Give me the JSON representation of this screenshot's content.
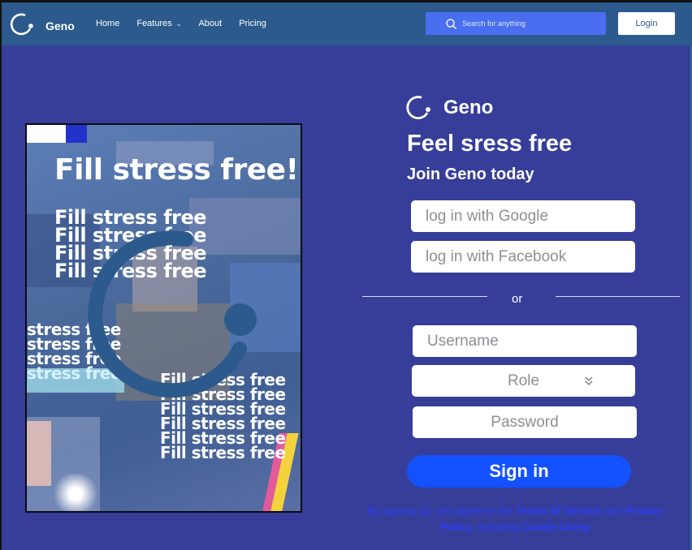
{
  "nav": {
    "brand": "Geno",
    "links": [
      {
        "label": "Home"
      },
      {
        "label": "Features",
        "has_dropdown": true
      },
      {
        "label": "About"
      },
      {
        "label": "Pricing"
      }
    ],
    "search_placeholder": "Search for anything",
    "login_label": "Login"
  },
  "poster": {
    "title": "Fill stress free!",
    "repeat_text": "Fill stress free",
    "short_text": "stress free",
    "ring_color": "#2C5A8C"
  },
  "form": {
    "logo_name": "Geno",
    "headline": "Feel sress free",
    "subhead": "Join Geno today",
    "google_label": "log in with Google",
    "facebook_label": "log in with Facebook",
    "or_label": "or",
    "username_placeholder": "Username",
    "role_selected": "Role",
    "password_placeholder": "Password",
    "signin_label": "Sign in",
    "terms": {
      "prefix": "By signing up, you agree to the",
      "tos": "Terms Of Service",
      "middle": "and",
      "privacy": "Privacy Policy",
      "including": ", including",
      "cookie": "Cookie Using"
    }
  },
  "colors": {
    "background": "#363E9A",
    "nav": "#2C5A8C",
    "search": "#4A6EF0",
    "signin": "#1451FF",
    "terms_link": "#2A3CF5"
  }
}
